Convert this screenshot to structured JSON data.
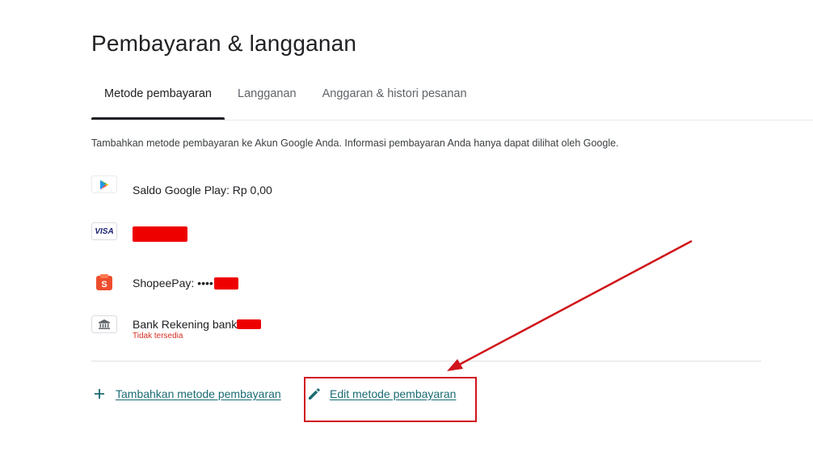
{
  "page": {
    "title": "Pembayaran & langganan"
  },
  "tabs": [
    {
      "label": "Metode pembayaran",
      "active": true
    },
    {
      "label": "Langganan",
      "active": false
    },
    {
      "label": "Anggaran & histori pesanan",
      "active": false
    }
  ],
  "description": "Tambahkan metode pembayaran ke Akun Google Anda. Informasi pembayaran Anda hanya dapat dilihat oleh Google.",
  "methods": [
    {
      "icon": "google-play-icon",
      "label": "Saldo Google Play: Rp 0,00"
    },
    {
      "icon": "visa-icon",
      "icon_text": "VISA",
      "label": ""
    },
    {
      "icon": "shopeepay-icon",
      "icon_text": "S",
      "label": "ShopeePay: ••••"
    },
    {
      "icon": "bank-icon",
      "label": "Bank Rekening bank",
      "status": "Tidak tersedia"
    }
  ],
  "actions": {
    "add_label": "Tambahkan metode pembayaran",
    "edit_label": "Edit metode pembayaran"
  },
  "colors": {
    "link": "#1a6b73",
    "redaction": "#ee0000",
    "annotation": "#d0141a",
    "error": "#d93025"
  }
}
